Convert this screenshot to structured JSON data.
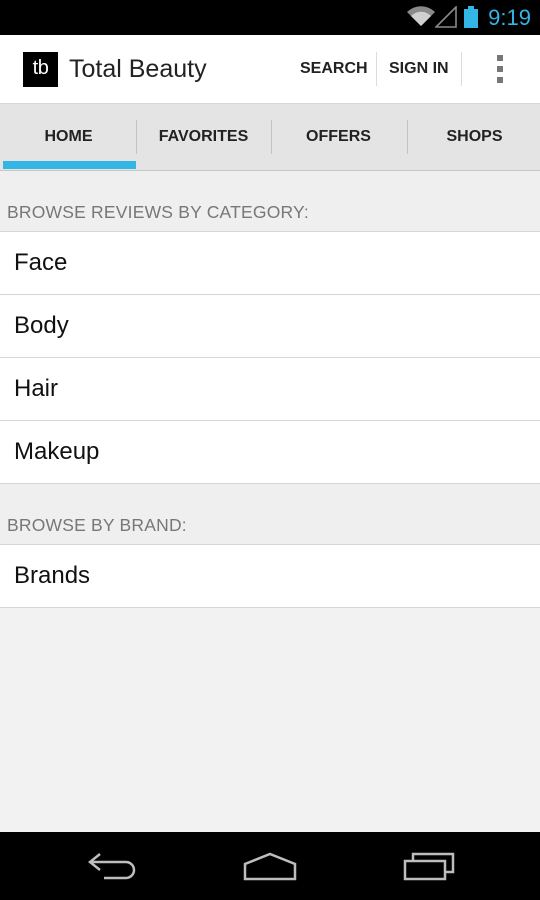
{
  "status_bar": {
    "time": "9:19",
    "icons": [
      "wifi-icon",
      "cell-signal-icon",
      "battery-icon"
    ],
    "time_color": "#33b5e5"
  },
  "action_bar": {
    "logo_text": "tb",
    "title": "Total Beauty",
    "search_label": "SEARCH",
    "sign_in_label": "SIGN IN",
    "overflow_icon": "overflow-menu-icon"
  },
  "tabs": [
    {
      "label": "HOME",
      "selected": true
    },
    {
      "label": "FAVORITES",
      "selected": false
    },
    {
      "label": "OFFERS",
      "selected": false
    },
    {
      "label": "SHOPS",
      "selected": false
    }
  ],
  "accent_color": "#33b5e5",
  "sections": {
    "category": {
      "header": "BROWSE REVIEWS BY CATEGORY:",
      "items": [
        "Face",
        "Body",
        "Hair",
        "Makeup"
      ]
    },
    "brand": {
      "header": "BROWSE BY BRAND:",
      "items": [
        "Brands"
      ]
    }
  },
  "nav_bar": {
    "icons": [
      "back-icon",
      "home-icon",
      "recent-apps-icon"
    ]
  }
}
